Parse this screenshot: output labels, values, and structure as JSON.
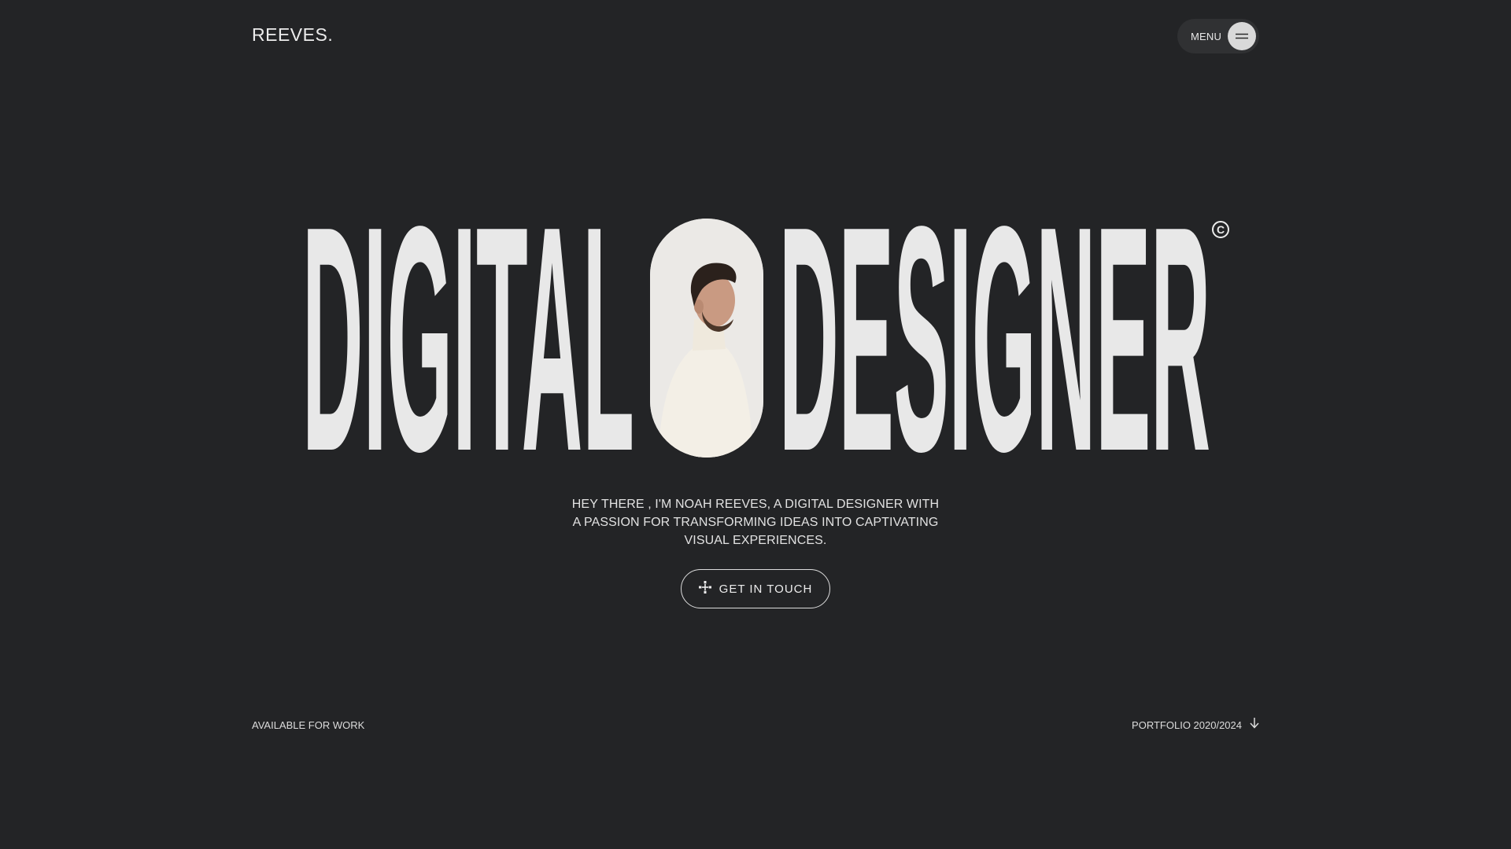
{
  "header": {
    "logo": "REEVES.",
    "menu_label": "MENU",
    "menu_icon": "hamburger-icon"
  },
  "hero": {
    "title_left": "DIGITAL",
    "title_right": "DESIGNER",
    "copyright_symbol": "C",
    "portrait_description": "portrait-photo"
  },
  "intro": {
    "text": "HEY THERE , I'M NOAH REEVES, A DIGITAL DESIGNER WITH A PASSION FOR TRANSFORMING IDEAS INTO CAPTIVATING VISUAL EXPERIENCES.",
    "cta_label": "GET IN TOUCH",
    "cta_icon": "sparkle-icon"
  },
  "footer": {
    "availability": "AVAILABLE FOR WORK",
    "portfolio_label": "PORTFOLIO 2020/2024",
    "portfolio_icon": "arrow-down-icon"
  },
  "colors": {
    "background": "#232426",
    "text": "#e6e6e6",
    "pill": "#303133"
  }
}
